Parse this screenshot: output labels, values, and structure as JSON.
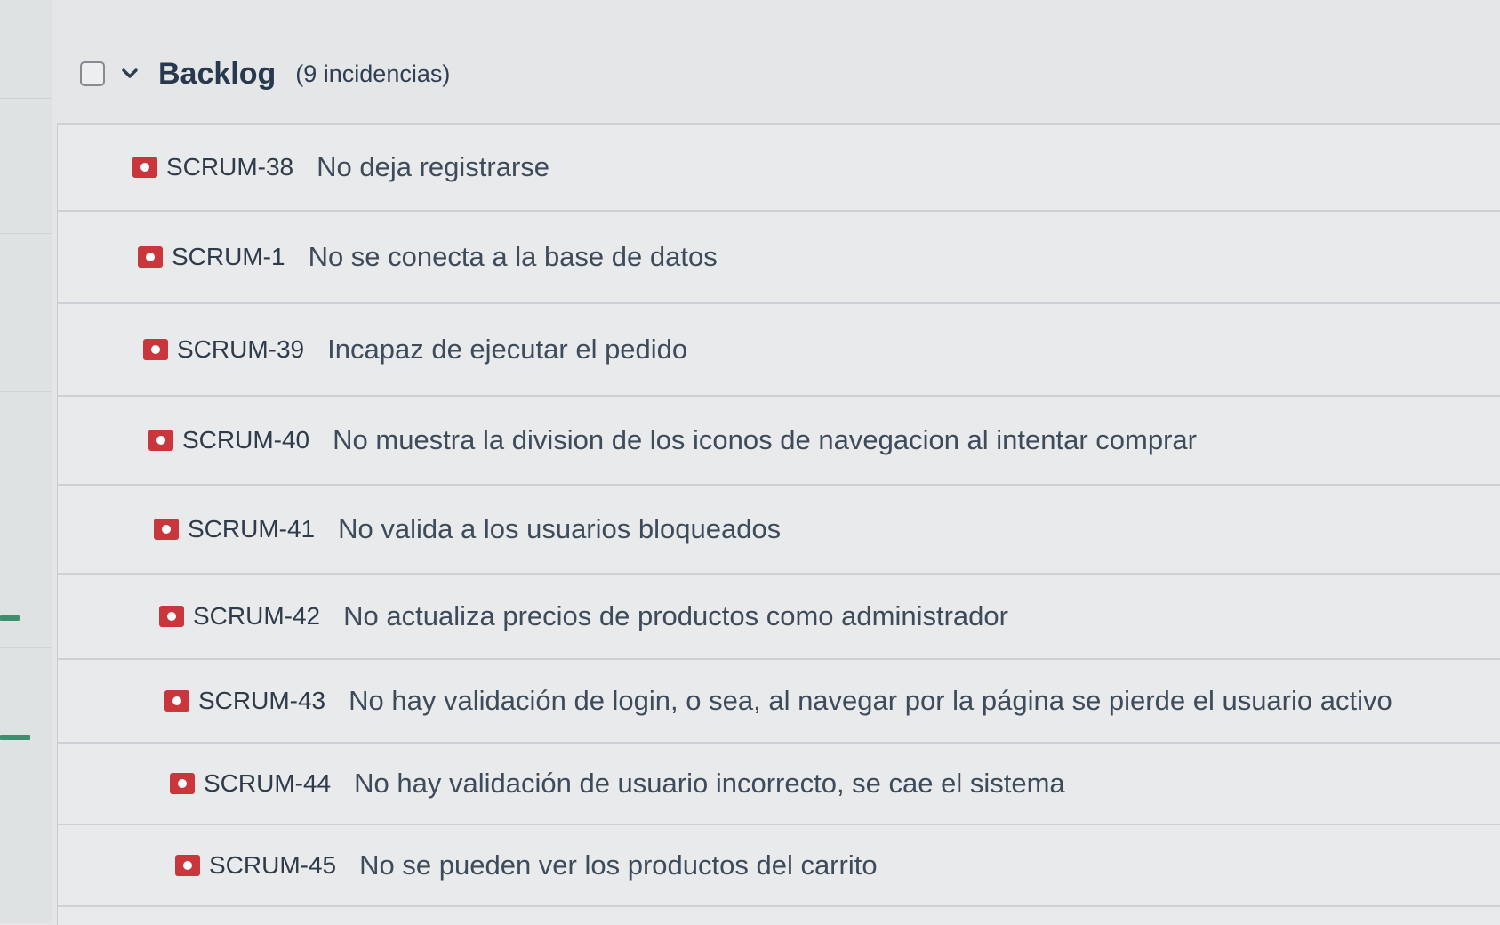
{
  "backlog": {
    "title": "Backlog",
    "count_label": "(9 incidencias)",
    "issue_type_icon": "bug-icon",
    "accent_color": "#c9373d",
    "issues": [
      {
        "key": "SCRUM-38",
        "summary": "No deja registrarse"
      },
      {
        "key": "SCRUM-1",
        "summary": "No se conecta a la base de datos"
      },
      {
        "key": "SCRUM-39",
        "summary": "Incapaz de ejecutar el pedido"
      },
      {
        "key": "SCRUM-40",
        "summary": "No muestra la division de los iconos de navegacion al intentar comprar"
      },
      {
        "key": "SCRUM-41",
        "summary": "No valida a los usuarios bloqueados"
      },
      {
        "key": "SCRUM-42",
        "summary": "No actualiza precios de productos como administrador"
      },
      {
        "key": "SCRUM-43",
        "summary": "No hay validación de login, o sea, al navegar por la página se pierde el usuario activo"
      },
      {
        "key": "SCRUM-44",
        "summary": "No hay validación de usuario incorrecto, se cae el sistema"
      },
      {
        "key": "SCRUM-45",
        "summary": "No se pueden ver los productos del carrito"
      }
    ]
  }
}
